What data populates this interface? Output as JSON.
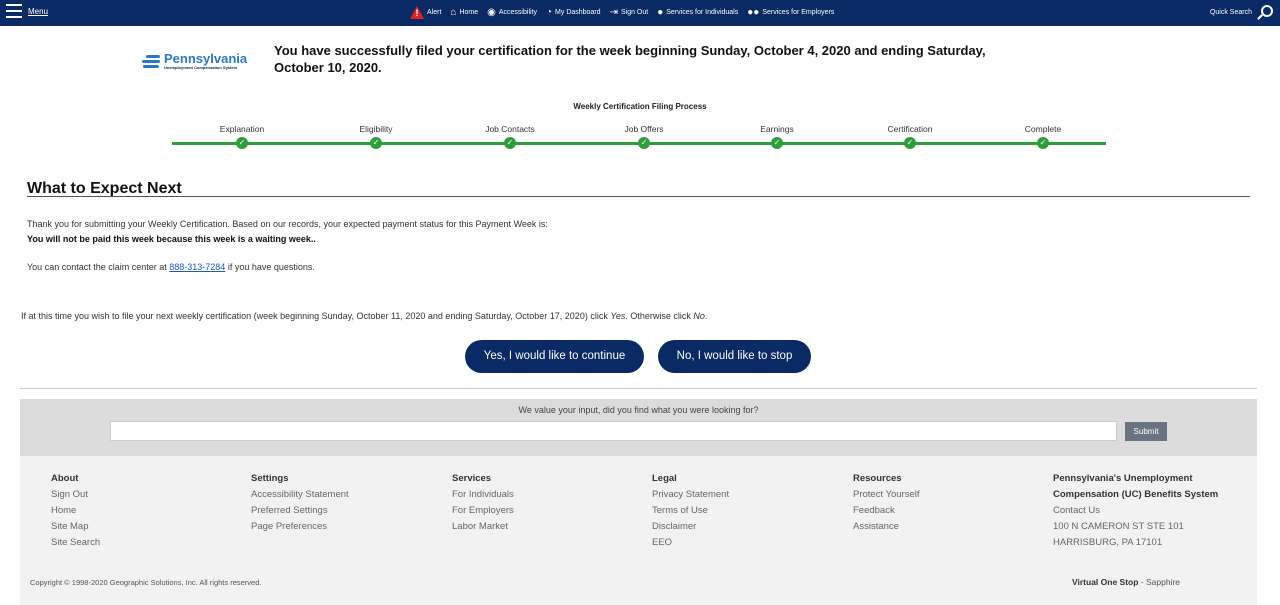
{
  "nav": {
    "menu_label": "Menu",
    "alert": "Alert",
    "home": "Home",
    "accessibility": "Accessibility",
    "dashboard": "My Dashboard",
    "sign_out": "Sign Out",
    "individuals": "Services for Individuals",
    "employers": "Services for Employers",
    "quick_search": "Quick Search"
  },
  "logo": {
    "name": "Pennsylvania",
    "subtitle": "Unemployment Compensation System"
  },
  "headline": "You have successfully filed your certification for the week beginning Sunday, October 4, 2020 and ending Saturday, October 10, 2020.",
  "process": {
    "title": "Weekly Certification Filing Process",
    "steps": [
      "Explanation",
      "Eligibility",
      "Job Contacts",
      "Job Offers",
      "Earnings",
      "Certification",
      "Complete"
    ],
    "completed": 7,
    "check": "✓"
  },
  "section": {
    "title": "What to Expect Next",
    "line1": "Thank you for submitting your Weekly Certification. Based on our records, your expected payment status for this Payment Week is:",
    "line2": "You will not be paid this week because this week is a waiting week..",
    "contact_pre": "You can contact the claim center at ",
    "phone": "888-313-7284",
    "contact_post": " if you have questions.",
    "next_pre": "If at this time you wish to file your next weekly certification (week beginning Sunday, October 11, 2020 and ending Saturday, October 17, 2020) click ",
    "yes_word": "Yes",
    "next_mid": ". Otherwise click ",
    "no_word": "No",
    "next_end": "."
  },
  "buttons": {
    "yes": "Yes, I would like to continue",
    "no": "No, I would like to stop"
  },
  "feedback": {
    "question": "We value your input, did you find what you were looking for?",
    "input_value": "",
    "submit": "Submit"
  },
  "footer": {
    "about": {
      "title": "About",
      "items": [
        "Sign Out",
        "Home",
        "Site Map",
        "Site Search"
      ]
    },
    "settings": {
      "title": "Settings",
      "items": [
        "Accessibility Statement",
        "Preferred Settings",
        "Page Preferences"
      ]
    },
    "services": {
      "title": "Services",
      "items": [
        "For Individuals",
        "For Employers",
        "Labor Market"
      ]
    },
    "legal": {
      "title": "Legal",
      "items": [
        "Privacy Statement",
        "Terms of Use",
        "Disclaimer",
        "EEO"
      ]
    },
    "resources": {
      "title": "Resources",
      "items": [
        "Protect Yourself",
        "Feedback",
        "Assistance"
      ]
    },
    "system": {
      "title": "Pennsylvania's Unemployment Compensation (UC) Benefits System",
      "items": [
        "Contact Us",
        "100 N CAMERON ST STE 101",
        "HARRISBURG, PA 17101"
      ]
    },
    "copyright": "Copyright © 1998-2020 Geographic Solutions, Inc. All rights reserved.",
    "vos_brand": "Virtual One Stop",
    "vos_suffix": " - Sapphire"
  },
  "colors": {
    "nav_bg": "#0a2a66",
    "progress_green": "#2e9e3a",
    "button_bg": "#0a2a66",
    "link": "#1a5bc4"
  }
}
